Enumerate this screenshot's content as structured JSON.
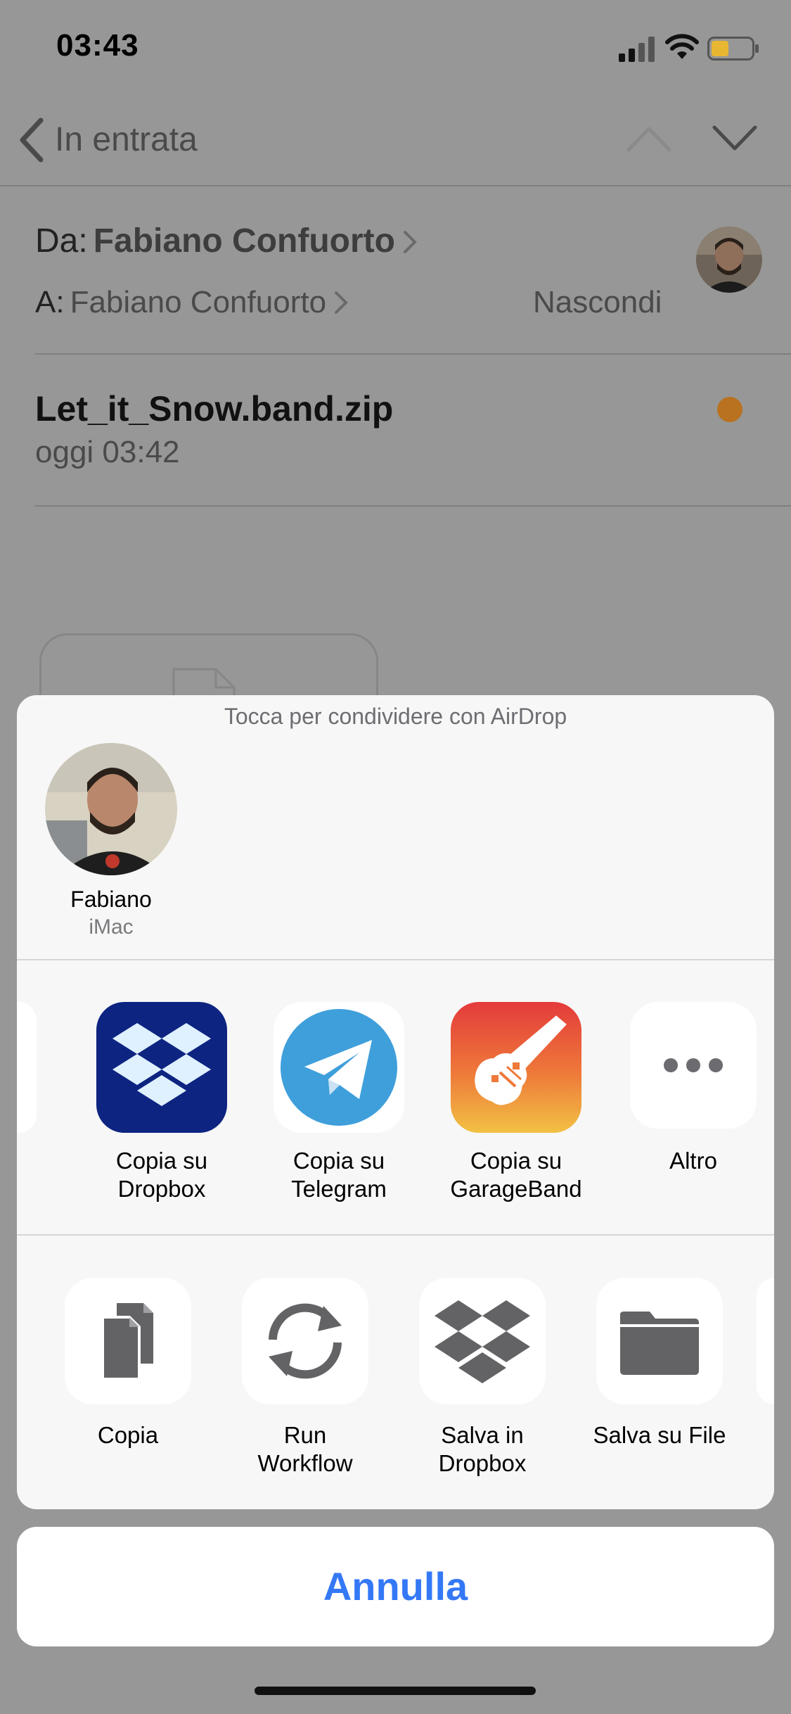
{
  "status_bar": {
    "time": "03:43"
  },
  "nav": {
    "back_label": "In entrata"
  },
  "mail": {
    "from_label": "Da:",
    "from_name": "Fabiano Confuorto",
    "to_label": "A:",
    "to_name": "Fabiano Confuorto",
    "hide_label": "Nascondi",
    "subject": "Let_it_Snow.band.zip",
    "date": "oggi 03:42"
  },
  "share_sheet": {
    "airdrop_hint": "Tocca per condividere con AirDrop",
    "airdrop_people": [
      {
        "name": "Fabiano",
        "device": "iMac"
      }
    ],
    "apps": [
      {
        "line1": "Copia su",
        "line2": "Dropbox",
        "icon": "dropbox-app-icon"
      },
      {
        "line1": "Copia su",
        "line2": "Telegram",
        "icon": "telegram-app-icon"
      },
      {
        "line1": "Copia su",
        "line2": "GarageBand",
        "icon": "garageband-app-icon"
      },
      {
        "line1": "Altro",
        "line2": "",
        "icon": "more-icon"
      }
    ],
    "actions": [
      {
        "line1": "Copia",
        "line2": "",
        "icon": "copy-icon"
      },
      {
        "line1": "Run",
        "line2": "Workflow",
        "icon": "refresh-icon"
      },
      {
        "line1": "Salva in",
        "line2": "Dropbox",
        "icon": "dropbox-icon"
      },
      {
        "line1": "Salva su File",
        "line2": "",
        "icon": "folder-icon"
      }
    ],
    "cancel_label": "Annulla"
  },
  "colors": {
    "accent": "#3478f6",
    "dim_background": "#979797",
    "sheet_background": "#f7f7f7",
    "unread_dot": "#b87220",
    "dropbox_blue": "#0d2481",
    "telegram_blue": "#3f9fdb",
    "action_gray": "#636366"
  }
}
